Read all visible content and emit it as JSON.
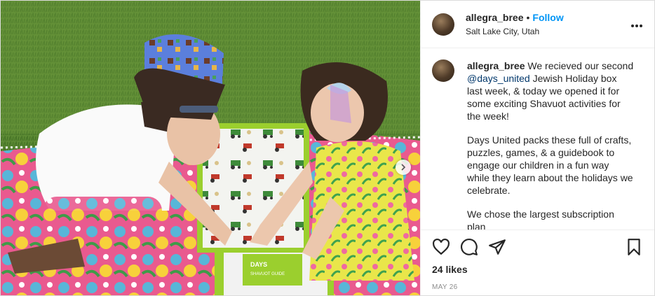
{
  "post": {
    "username": "allegra_bree",
    "follow_label": "Follow",
    "separator": "•",
    "location": "Salt Lake City, Utah",
    "caption": {
      "username": "allegra_bree",
      "paragraph1_start": "We recieved our second ",
      "mention": "@days_united",
      "paragraph1_end": " Jewish Holiday box last week, & today we opened it for some exciting Shavuot activities for the week!",
      "paragraph2": "Days United packs these full of crafts, puzzles, games, & a guidebook to engage our children in a fun way while they learn about the holidays we celebrate.",
      "paragraph3": "We chose the largest subscription plan"
    },
    "likes": "24 likes",
    "date": "MAY 26",
    "photo": {
      "box_guide_title": "DAYS",
      "box_guide_subtitle": "SHAVUOT GUIDE"
    }
  },
  "icons": {
    "like": "heart-icon",
    "comment": "comment-icon",
    "share": "share-icon",
    "save": "bookmark-icon",
    "more": "more-options-icon",
    "next": "chevron-right-icon"
  },
  "colors": {
    "follow_blue": "#0095f6",
    "mention_blue": "#00376b",
    "box_green": "#9bcf2e"
  }
}
